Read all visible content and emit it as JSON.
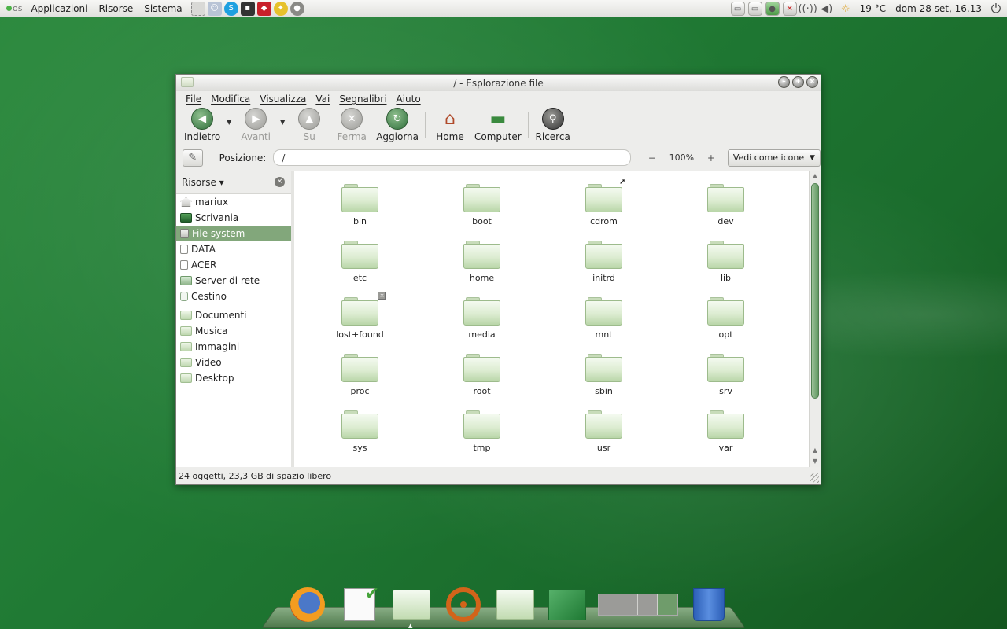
{
  "top_panel": {
    "logo_text": "os",
    "menus": [
      "Applicazioni",
      "Risorse",
      "Sistema"
    ],
    "temperature": "19 °C",
    "clock": "dom 28 set, 16.13"
  },
  "window": {
    "title": "/ - Esplorazione file",
    "menus": [
      "File",
      "Modifica",
      "Visualizza",
      "Vai",
      "Segnalibri",
      "Aiuto"
    ],
    "toolbar": {
      "back": "Indietro",
      "forward": "Avanti",
      "up": "Su",
      "stop": "Ferma",
      "reload": "Aggiorna",
      "home": "Home",
      "computer": "Computer",
      "search": "Ricerca"
    },
    "location": {
      "label": "Posizione:",
      "value": "/",
      "zoom": "100%",
      "zoom_minus": "−",
      "zoom_plus": "+",
      "view_mode": "Vedi come icone"
    },
    "sidebar": {
      "title": "Risorse",
      "places": [
        "mariux",
        "Scrivania",
        "File system",
        "DATA",
        "ACER",
        "Server di rete",
        "Cestino"
      ],
      "bookmarks": [
        "Documenti",
        "Musica",
        "Immagini",
        "Video",
        "Desktop"
      ],
      "active": "File system"
    },
    "files": [
      "bin",
      "boot",
      "cdrom",
      "dev",
      "etc",
      "home",
      "initrd",
      "lib",
      "lost+found",
      "media",
      "mnt",
      "opt",
      "proc",
      "root",
      "sbin",
      "srv",
      "sys",
      "tmp",
      "usr",
      "var"
    ],
    "status": "24 oggetti, 23,3 GB di spazio libero"
  }
}
